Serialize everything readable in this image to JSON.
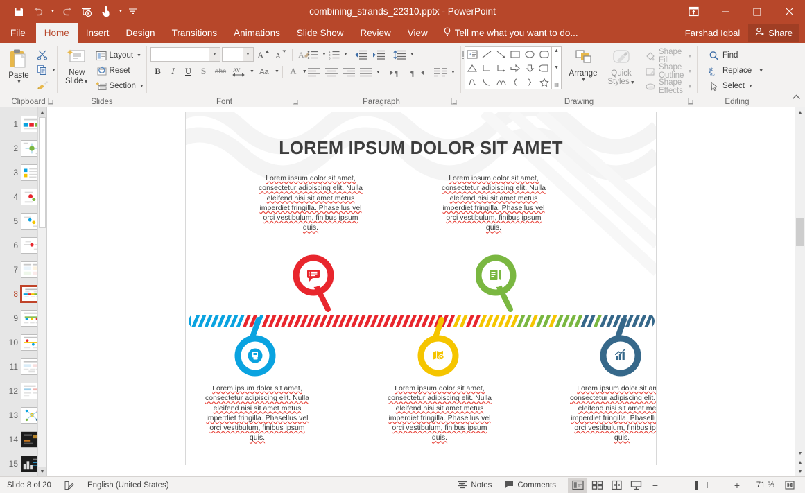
{
  "window": {
    "title": "combining_strands_22310.pptx - PowerPoint",
    "quick_access": [
      {
        "name": "save-icon",
        "label": "Save"
      },
      {
        "name": "undo-icon",
        "label": "Undo"
      },
      {
        "name": "redo-icon",
        "label": "Redo"
      },
      {
        "name": "start-presentation-icon",
        "label": "Start From Beginning"
      },
      {
        "name": "touch-mode-icon",
        "label": "Touch/Mouse Mode"
      },
      {
        "name": "customize-qat-icon",
        "label": "Customize Quick Access Toolbar"
      }
    ],
    "controls": [
      {
        "name": "ribbon-display-options-button",
        "label": "Ribbon Display Options"
      },
      {
        "name": "minimize-button",
        "label": "Minimize"
      },
      {
        "name": "restore-button",
        "label": "Restore Down"
      },
      {
        "name": "close-button",
        "label": "Close"
      }
    ]
  },
  "ribbon": {
    "tabs": [
      {
        "label": "File",
        "active": false
      },
      {
        "label": "Home",
        "active": true
      },
      {
        "label": "Insert",
        "active": false
      },
      {
        "label": "Design",
        "active": false
      },
      {
        "label": "Transitions",
        "active": false
      },
      {
        "label": "Animations",
        "active": false
      },
      {
        "label": "Slide Show",
        "active": false
      },
      {
        "label": "Review",
        "active": false
      },
      {
        "label": "View",
        "active": false
      }
    ],
    "tell_me": "Tell me what you want to do...",
    "user_name": "Farshad Iqbal",
    "share_label": "Share",
    "groups": {
      "clipboard": {
        "label": "Clipboard",
        "paste": "Paste",
        "cut": "Cut",
        "copy": "Copy",
        "format_painter": "Format Painter"
      },
      "slides": {
        "label": "Slides",
        "new_slide": "New\nSlide",
        "new_slide_line1": "New",
        "new_slide_line2": "Slide",
        "layout": "Layout",
        "reset": "Reset",
        "section": "Section"
      },
      "font": {
        "label": "Font",
        "font_name": "",
        "font_size": "",
        "grow_font": "A",
        "shrink_font": "A",
        "clear_formatting": "Clear All Formatting",
        "bold": "B",
        "italic": "I",
        "underline": "U",
        "shadow": "S",
        "strikethrough": "abc",
        "character_spacing": "AV",
        "change_case": "Aa",
        "font_color": "A"
      },
      "paragraph": {
        "label": "Paragraph",
        "bullets": "Bullets",
        "numbering": "Numbering",
        "decrease_indent": "Decrease List Level",
        "increase_indent": "Increase List Level",
        "line_spacing": "Line Spacing",
        "text_direction": "Text Direction",
        "align_text": "Align Text",
        "convert_smartart": "Convert to SmartArt",
        "align_left": "Align Left",
        "center": "Center",
        "align_right": "Align Right",
        "justify": "Justify",
        "ltr": "Left-to-Right",
        "rtl": "Right-to-Left",
        "columns": "Columns"
      },
      "drawing": {
        "label": "Drawing",
        "arrange": "Arrange",
        "quick_styles_line1": "Quick",
        "quick_styles_line2": "Styles",
        "shape_fill": "Shape Fill",
        "shape_outline": "Shape Outline",
        "shape_effects": "Shape Effects"
      },
      "editing": {
        "label": "Editing",
        "find": "Find",
        "replace": "Replace",
        "select": "Select"
      }
    },
    "collapse_label": "Collapse the Ribbon"
  },
  "thumbnails": {
    "slides": [
      {
        "number": "1",
        "selected": false,
        "dark": false
      },
      {
        "number": "2",
        "selected": false,
        "dark": false
      },
      {
        "number": "3",
        "selected": false,
        "dark": false
      },
      {
        "number": "4",
        "selected": false,
        "dark": false
      },
      {
        "number": "5",
        "selected": false,
        "dark": false
      },
      {
        "number": "6",
        "selected": false,
        "dark": false
      },
      {
        "number": "7",
        "selected": false,
        "dark": false
      },
      {
        "number": "8",
        "selected": true,
        "dark": false
      },
      {
        "number": "9",
        "selected": false,
        "dark": false
      },
      {
        "number": "10",
        "selected": false,
        "dark": false
      },
      {
        "number": "11",
        "selected": false,
        "dark": false
      },
      {
        "number": "12",
        "selected": false,
        "dark": false
      },
      {
        "number": "13",
        "selected": false,
        "dark": false
      },
      {
        "number": "14",
        "selected": false,
        "dark": true
      },
      {
        "number": "15",
        "selected": false,
        "dark": true
      }
    ]
  },
  "slide": {
    "title": "LOREM IPSUM DOLOR SIT AMET",
    "body_text": "Lorem ipsum dolor sit amet, consectetur adipiscing elit. Nulla eleifend nisi sit amet metus imperdiet fringilla. Phasellus vel orci vestibulum, finibus ipsum quis.",
    "callouts": [
      {
        "id": "top-1",
        "position": "top",
        "color": "#e8262d",
        "icon": "speech-bubble-list-icon"
      },
      {
        "id": "top-2",
        "position": "top",
        "color": "#7ab741",
        "icon": "checklist-document-icon"
      },
      {
        "id": "bottom-1",
        "position": "bottom",
        "color": "#0aa3e0",
        "icon": "document-icon"
      },
      {
        "id": "bottom-2",
        "position": "bottom",
        "color": "#f5c500",
        "icon": "map-pin-icon"
      },
      {
        "id": "bottom-3",
        "position": "bottom",
        "color": "#36688a",
        "icon": "bar-chart-icon"
      }
    ],
    "rope_colors": [
      "#0aa3e0",
      "#e8262d",
      "#f5c500",
      "#7ab741",
      "#36688a"
    ]
  },
  "statusbar": {
    "slide_counter": "Slide 8 of 20",
    "language": "English (United States)",
    "notes": "Notes",
    "comments": "Comments",
    "views": [
      {
        "name": "normal-view-button",
        "label": "Normal",
        "active": true
      },
      {
        "name": "slide-sorter-view-button",
        "label": "Slide Sorter",
        "active": false
      },
      {
        "name": "reading-view-button",
        "label": "Reading View",
        "active": false
      },
      {
        "name": "slide-show-button",
        "label": "Slide Show",
        "active": false
      }
    ],
    "zoom_out": "−",
    "zoom_in": "+",
    "zoom_level": "71 %",
    "fit_slide": "Fit slide to current window"
  }
}
